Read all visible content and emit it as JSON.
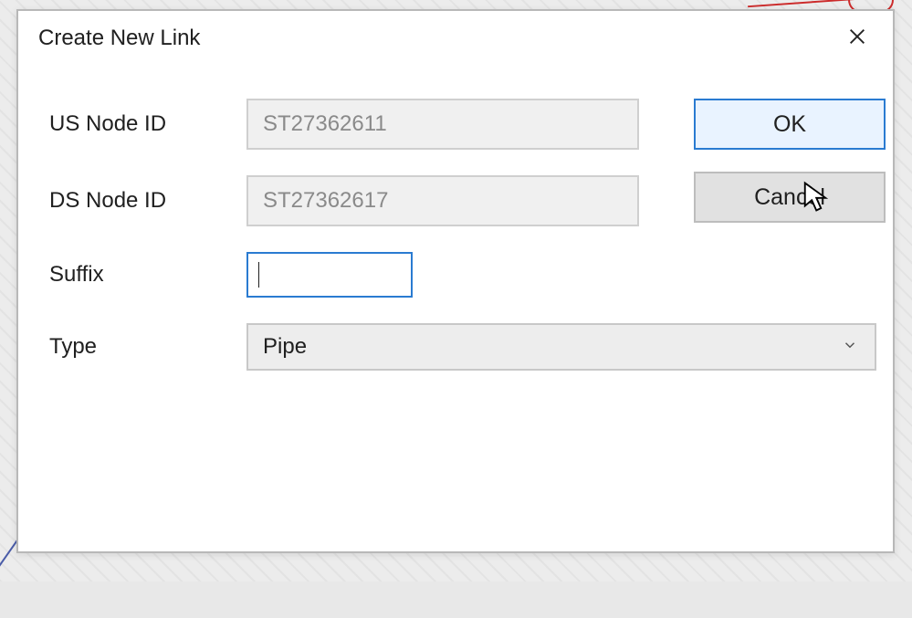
{
  "dialog": {
    "title": "Create New Link",
    "close_icon": "close"
  },
  "fields": {
    "us_node": {
      "label": "US Node ID",
      "value": "ST27362611"
    },
    "ds_node": {
      "label": "DS Node ID",
      "value": "ST27362617"
    },
    "suffix": {
      "label": "Suffix",
      "value": ""
    },
    "type": {
      "label": "Type",
      "selected": "Pipe"
    }
  },
  "buttons": {
    "ok": "OK",
    "cancel": "Cancel"
  },
  "colors": {
    "highlight_border": "#2a7bd1",
    "ok_bg": "#e9f3ff",
    "readonly_bg": "#f0f0f0",
    "readonly_text": "#8a8a8a"
  }
}
